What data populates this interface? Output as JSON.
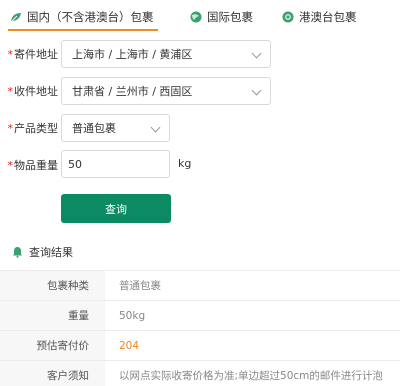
{
  "tabs": [
    {
      "label": "国内（不含港澳台）包裹",
      "icon": "leaf-icon",
      "active": true
    },
    {
      "label": "国际包裹",
      "icon": "globe-icon",
      "active": false
    },
    {
      "label": "港澳台包裹",
      "icon": "target-icon",
      "active": false
    }
  ],
  "form": {
    "sender": {
      "label": "寄件地址",
      "value": "上海市 / 上海市 / 黄浦区"
    },
    "receiver": {
      "label": "收件地址",
      "value": "甘肃省 / 兰州市 / 西固区"
    },
    "product": {
      "label": "产品类型",
      "value": "普通包裹"
    },
    "weight": {
      "label": "物品重量",
      "value": "50",
      "unit": "kg"
    },
    "required_mark": "*"
  },
  "query_button": "查询",
  "results": {
    "title": "查询结果",
    "rows": [
      {
        "key": "包裹种类",
        "value": "普通包裹"
      },
      {
        "key": "重量",
        "value": "50kg"
      },
      {
        "key": "预估寄付价",
        "value": "204"
      },
      {
        "key": "客户须知",
        "value": "以网点实际收寄价格为准;单边超过50cm的邮件进行计泡"
      }
    ]
  },
  "colors": {
    "accent": "#f28a1e",
    "primary_button": "#0c8a63",
    "price": "#f08519",
    "required": "#e02020"
  }
}
